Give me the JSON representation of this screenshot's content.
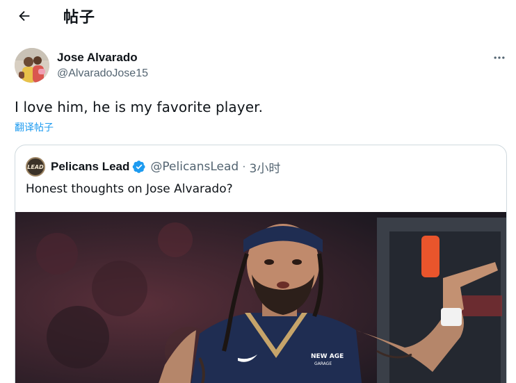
{
  "header": {
    "title": "帖子",
    "back_icon": "arrow-left-icon"
  },
  "author": {
    "name": "Jose Alvarado",
    "handle": "@AlvaradoJose15",
    "more_icon": "more-horizontal-icon"
  },
  "tweet": {
    "text": "I love him, he is my favorite player.",
    "translate_label": "翻译帖子"
  },
  "quoted_tweet": {
    "avatar_text": "LEAD",
    "name": "Pelicans Lead",
    "verified_icon": "verified-badge-icon",
    "handle": "@PelicansLead",
    "separator": "·",
    "time": "3小时",
    "text": "Honest thoughts on Jose Alvarado?",
    "media_icon": "player-photo",
    "jersey_text_1": "NEW AGE",
    "jersey_text_2": "GARAGE"
  },
  "colors": {
    "accent": "#1d9bf0",
    "text_primary": "#0f1419",
    "text_secondary": "#536471",
    "border": "#cfd9de"
  }
}
